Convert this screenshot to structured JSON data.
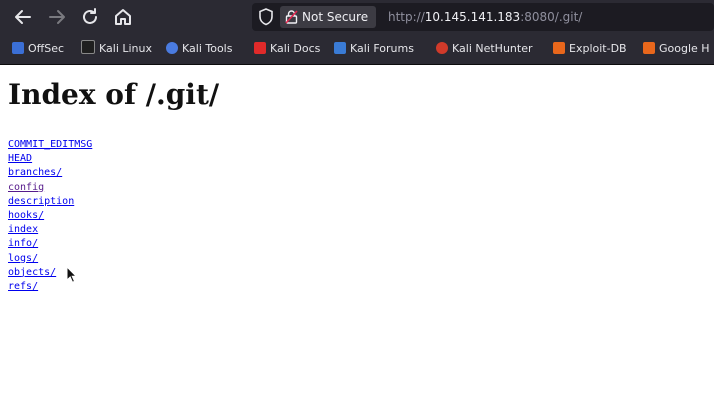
{
  "toolbar": {
    "security_label": "Not Secure",
    "url": {
      "scheme": "http://",
      "host": "10.145.141.183",
      "rest": ":8080/.git/"
    }
  },
  "bookmarks": [
    {
      "label": "OffSec",
      "color": "#3b6fd6"
    },
    {
      "label": "Kali Linux",
      "color": "#1f1f1f"
    },
    {
      "label": "Kali Tools",
      "color": "#4a7be0"
    },
    {
      "label": "Kali Docs",
      "color": "#e02a2a"
    },
    {
      "label": "Kali Forums",
      "color": "#3a7bd5"
    },
    {
      "label": "Kali NetHunter",
      "color": "#d03a2a"
    },
    {
      "label": "Exploit-DB",
      "color": "#e8671c"
    },
    {
      "label": "Google H",
      "color": "#e8671c"
    }
  ],
  "page": {
    "heading": "Index of /.git/",
    "entries": [
      "COMMIT_EDITMSG",
      "HEAD",
      "branches/",
      "config",
      "description",
      "hooks/",
      "index",
      "info/",
      "logs/",
      "objects/",
      "refs/"
    ]
  },
  "colors": {
    "link": "#0000ee",
    "visited": "#551a8b",
    "toolbar_bg": "#2b2a33",
    "urlbar_bg": "#1c1b22"
  }
}
